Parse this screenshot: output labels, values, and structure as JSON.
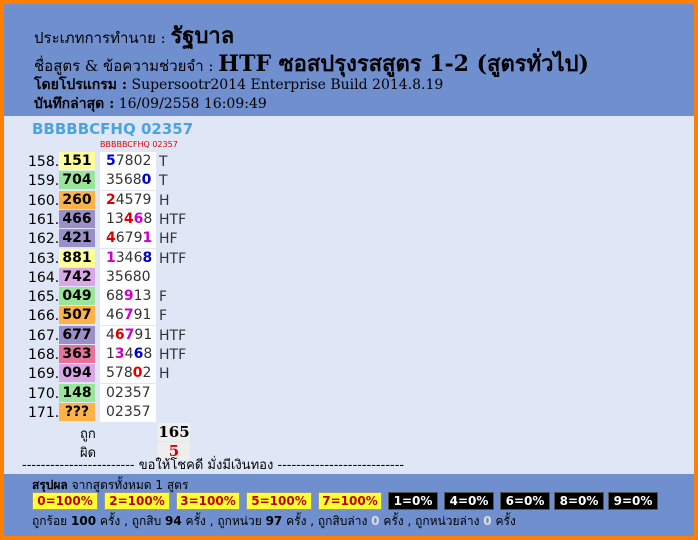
{
  "header": {
    "type_label": "ประเภทการทำนาย :",
    "type_value": "รัฐบาล",
    "formula_label": "ชื่อสูตร & ข้อความช่วยจำ :",
    "formula_value": "HTF ซอสปรุงรสสูตร 1-2 (สูตรทั่วไป)",
    "program_label": "โดยโปรแกรม :",
    "program_value": "Supersootr2014 Enterprise Build 2014.8.19",
    "saved_label": "บันทึกล่าสุด :",
    "saved_value": "16/09/2558 16:09:49"
  },
  "system_code": "BBBBBCFHQ 02357",
  "column_header": "BBBBBCFHQ 02357",
  "rows": [
    {
      "num": "158.",
      "result": "151",
      "bg": "#ffff99",
      "digits": [
        [
          "5",
          "hb"
        ],
        [
          "7802",
          ""
        ]
      ],
      "tag": "T"
    },
    {
      "num": "159.",
      "result": "704",
      "bg": "#99e699",
      "digits": [
        [
          "3568",
          ""
        ],
        [
          "0",
          "hb"
        ]
      ],
      "tag": "T"
    },
    {
      "num": "160.",
      "result": "260",
      "bg": "#ffb347",
      "digits": [
        [
          "2",
          "hr"
        ],
        [
          "4579",
          ""
        ]
      ],
      "tag": "H"
    },
    {
      "num": "161.",
      "result": "466",
      "bg": "#9b8fc7",
      "digits": [
        [
          "13",
          ""
        ],
        [
          "4",
          "hr"
        ],
        [
          "6",
          "hm"
        ],
        [
          "8",
          ""
        ]
      ],
      "tag": "HTF"
    },
    {
      "num": "162.",
      "result": "421",
      "bg": "#9b8fc7",
      "digits": [
        [
          "4",
          "hr"
        ],
        [
          "679",
          ""
        ],
        [
          "1",
          "hm"
        ]
      ],
      "tag": "HF"
    },
    {
      "num": "163.",
      "result": "881",
      "bg": "#ffff99",
      "digits": [
        [
          "1",
          "hm"
        ],
        [
          "346",
          ""
        ],
        [
          "8",
          "hb"
        ]
      ],
      "tag": "HTF"
    },
    {
      "num": "164.",
      "result": "742",
      "bg": "#d9a6e6",
      "digits": [
        [
          "35680",
          ""
        ]
      ],
      "tag": ""
    },
    {
      "num": "165.",
      "result": "049",
      "bg": "#99e699",
      "digits": [
        [
          "68",
          ""
        ],
        [
          "9",
          "hm"
        ],
        [
          "13",
          ""
        ]
      ],
      "tag": "F"
    },
    {
      "num": "166.",
      "result": "507",
      "bg": "#ffb347",
      "digits": [
        [
          "46",
          ""
        ],
        [
          "7",
          "hm"
        ],
        [
          "91",
          ""
        ]
      ],
      "tag": "F"
    },
    {
      "num": "167.",
      "result": "677",
      "bg": "#9b8fc7",
      "digits": [
        [
          "4",
          ""
        ],
        [
          "6",
          "hr"
        ],
        [
          "7",
          "hm"
        ],
        [
          "91",
          ""
        ]
      ],
      "tag": "HTF"
    },
    {
      "num": "168.",
      "result": "363",
      "bg": "#e8739a",
      "digits": [
        [
          "1",
          ""
        ],
        [
          "3",
          "hm"
        ],
        [
          "4",
          ""
        ],
        [
          "6",
          "hb"
        ],
        [
          "8",
          ""
        ]
      ],
      "tag": "HTF"
    },
    {
      "num": "169.",
      "result": "094",
      "bg": "#d9a6e6",
      "digits": [
        [
          "578",
          ""
        ],
        [
          "0",
          "hr"
        ],
        [
          "2",
          ""
        ]
      ],
      "tag": "H"
    },
    {
      "num": "170.",
      "result": "148",
      "bg": "#99e699",
      "digits": [
        [
          "02357",
          ""
        ]
      ],
      "tag": ""
    },
    {
      "num": "171.",
      "result": "???",
      "bg": "#ffb347",
      "digits": [
        [
          "02357",
          ""
        ]
      ],
      "tag": ""
    }
  ],
  "summary": {
    "correct_label": "ถูก",
    "correct_value": "165",
    "wrong_label": "ผิด",
    "wrong_value": "5"
  },
  "divider_text": "------------------------ ขอให้โชคดี มั่งมีเงินทอง ---------------------------",
  "footer": {
    "title_bold": "สรุปผล",
    "title_rest": " จากสูตรทั้งหมด 1 สูตร",
    "badges": [
      {
        "text": "0=100%",
        "style": "by"
      },
      {
        "text": "2=100%",
        "style": "by"
      },
      {
        "text": "3=100%",
        "style": "by"
      },
      {
        "text": "5=100%",
        "style": "by"
      },
      {
        "text": "7=100%",
        "style": "by"
      },
      {
        "text": "1=0%",
        "style": "bk"
      },
      {
        "text": "4=0%",
        "style": "bk"
      },
      {
        "text": "6=0%",
        "style": "bk"
      },
      {
        "text": "8=0%",
        "style": "bk"
      },
      {
        "text": "9=0%",
        "style": "bk"
      }
    ],
    "stats": {
      "s1_label": "ถูกร้อย",
      "s1_value": "100",
      "s1_unit": "ครั้ง , ถูกสิบ",
      "s2_value": "94",
      "s2_unit": "ครั้ง , ถูกหน่วย",
      "s3_value": "97",
      "s3_unit": "ครั้ง , ถูกสิบล่าง",
      "s4_value": "0",
      "s4_unit": "ครั้ง , ถูกหน่วยล่าง",
      "s5_value": "0",
      "s5_unit": "ครั้ง"
    }
  }
}
